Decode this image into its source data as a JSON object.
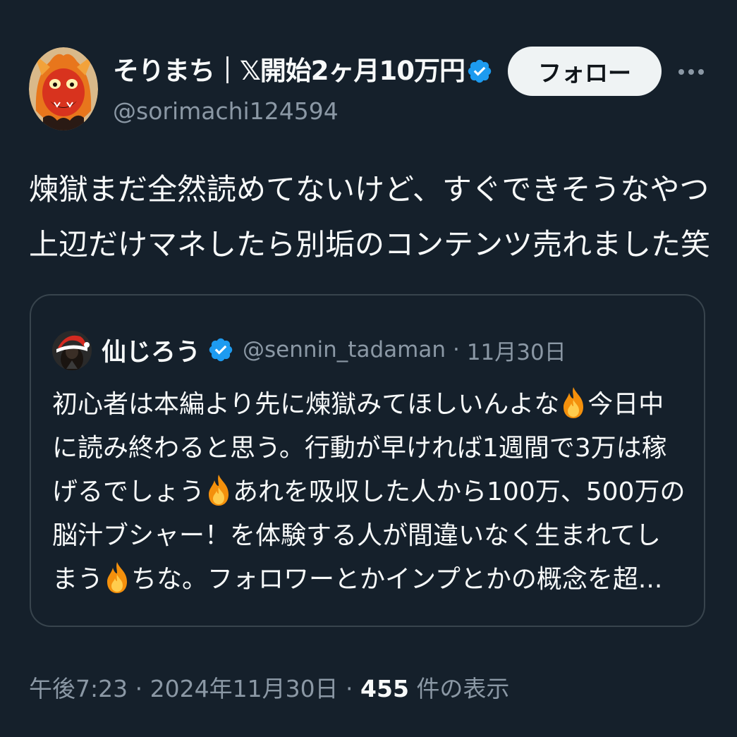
{
  "author": {
    "display_name": "そりまち｜𝕏開始2ヶ月10万円",
    "handle": "@sorimachi124594",
    "verified": true,
    "avatar_icon": "red-demon-avatar-icon"
  },
  "actions": {
    "follow_label": "フォロー",
    "more_icon": "more-icon"
  },
  "tweet": {
    "lines": [
      "煉獄まだ全然読めてないけど、すぐできそうなやつ",
      "上辺だけマネしたら別垢のコンテンツ売れました笑"
    ]
  },
  "quote": {
    "display_name": "仙じろう",
    "handle": "@sennin_tadaman",
    "separator": "·",
    "date": "11月30日",
    "verified": true,
    "avatar_icon": "santa-hat-avatar-icon",
    "line1_a": "初心者は本編より先に煉獄みてほしいんよな",
    "line1_b": "今日中",
    "line2": "に読み終わると思う。行動が早ければ1週間で3万は稼",
    "line3_a": "げるでしょう",
    "line3_b": "あれを吸収した人から100万、500万の",
    "line4": "脳汁ブシャー！を体験する人が間違いなく生まれてし",
    "line5_a": "まう",
    "line5_b": "ちな。フォロワーとかインプとかの概念を超..."
  },
  "meta": {
    "time": "午後7:23",
    "sep1": " · ",
    "date": "2024年11月30日",
    "sep2": " · ",
    "views_count": "455",
    "views_label": " 件の表示"
  },
  "colors": {
    "background": "#15202b",
    "text": "#f7f9f9",
    "secondary_text": "#8b98a5",
    "verified_blue": "#1d9bf0",
    "border": "#38444d",
    "follow_bg": "#eff3f4"
  }
}
